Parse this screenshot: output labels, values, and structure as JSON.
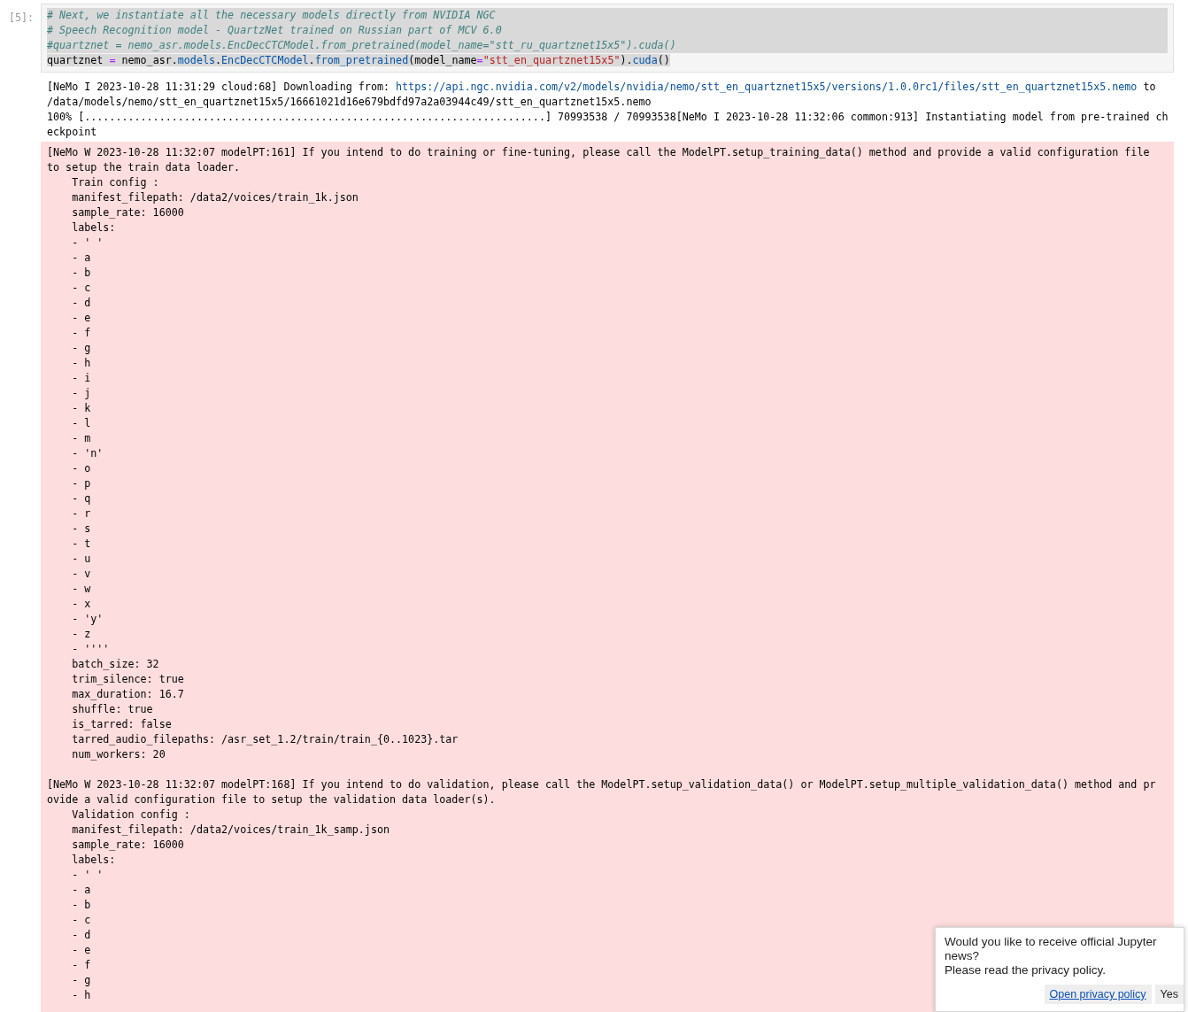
{
  "cell": {
    "prompt": "[5]:",
    "code_lines": [
      {
        "selected": true,
        "tokens": [
          {
            "kind": "comment",
            "text": "# Next, we instantiate all the necessary models directly from NVIDIA NGC"
          }
        ]
      },
      {
        "selected": true,
        "tokens": [
          {
            "kind": "comment",
            "text": "# Speech Recognition model - QuartzNet trained on Russian part of MCV 6.0"
          }
        ]
      },
      {
        "selected": true,
        "tokens": [
          {
            "kind": "comment",
            "text": "#quartznet = nemo_asr.models.EncDecCTCModel.from_pretrained(model_name=\"stt_ru_quartznet15x5\").cuda()"
          }
        ]
      },
      {
        "selected": true,
        "tokens": [
          {
            "kind": "plain",
            "text": "quartznet "
          },
          {
            "kind": "op",
            "text": "="
          },
          {
            "kind": "plain",
            "text": " nemo_asr."
          },
          {
            "kind": "attr",
            "text": "models"
          },
          {
            "kind": "plain",
            "text": "."
          },
          {
            "kind": "attr",
            "text": "EncDecCTCModel"
          },
          {
            "kind": "plain",
            "text": "."
          },
          {
            "kind": "attr",
            "text": "from_pretrained"
          },
          {
            "kind": "plain",
            "text": "(model_name"
          },
          {
            "kind": "op",
            "text": "="
          },
          {
            "kind": "string",
            "text": "\"stt_en_quartznet15x5\""
          },
          {
            "kind": "plain",
            "text": ")."
          },
          {
            "kind": "attr",
            "text": "cuda"
          },
          {
            "kind": "plain",
            "text": "()"
          }
        ]
      }
    ]
  },
  "stdout_lines": [
    [
      {
        "kind": "plain",
        "text": "[NeMo I 2023-10-28 11:31:29 cloud:68] Downloading from: "
      },
      {
        "kind": "link",
        "text": "https://api.ngc.nvidia.com/v2/models/nvidia/nemo/stt_en_quartznet15x5/versions/1.0.0rc1/files/stt_en_quartznet15x5.nemo"
      },
      {
        "kind": "plain",
        "text": " to"
      }
    ],
    [
      {
        "kind": "plain",
        "text": "/data/models/nemo/stt_en_quartznet15x5/16661021d16e679bdfd97a2a03944c49/stt_en_quartznet15x5.nemo"
      }
    ],
    [
      {
        "kind": "plain",
        "text": "100% [..........................................................................] 70993538 / 70993538[NeMo I 2023-10-28 11:32:06 common:913] Instantiating model from pre-trained ch"
      }
    ],
    [
      {
        "kind": "plain",
        "text": "eckpoint"
      }
    ]
  ],
  "warnings": [
    [
      "[NeMo W 2023-10-28 11:32:07 modelPT:161] If you intend to do training or fine-tuning, please call the ModelPT.setup_training_data() method and provide a valid configuration file",
      "to setup the train data loader.",
      "    Train config :",
      "    manifest_filepath: /data2/voices/train_1k.json",
      "    sample_rate: 16000",
      "    labels:",
      "    - ' '",
      "    - a",
      "    - b",
      "    - c",
      "    - d",
      "    - e",
      "    - f",
      "    - g",
      "    - h",
      "    - i",
      "    - j",
      "    - k",
      "    - l",
      "    - m",
      "    - 'n'",
      "    - o",
      "    - p",
      "    - q",
      "    - r",
      "    - s",
      "    - t",
      "    - u",
      "    - v",
      "    - w",
      "    - x",
      "    - 'y'",
      "    - z",
      "    - ''''",
      "    batch_size: 32",
      "    trim_silence: true",
      "    max_duration: 16.7",
      "    shuffle: true",
      "    is_tarred: false",
      "    tarred_audio_filepaths: /asr_set_1.2/train/train_{0..1023}.tar",
      "    num_workers: 20"
    ],
    [
      "[NeMo W 2023-10-28 11:32:07 modelPT:168] If you intend to do validation, please call the ModelPT.setup_validation_data() or ModelPT.setup_multiple_validation_data() method and pr",
      "ovide a valid configuration file to setup the validation data loader(s).",
      "    Validation config :",
      "    manifest_filepath: /data2/voices/train_1k_samp.json",
      "    sample_rate: 16000",
      "    labels:",
      "    - ' '",
      "    - a",
      "    - b",
      "    - c",
      "    - d",
      "    - e",
      "    - f",
      "    - g",
      "    - h"
    ]
  ],
  "notification": {
    "message_lines": [
      "Would you like to receive official Jupyter news?",
      "Please read the privacy policy."
    ],
    "buttons": [
      {
        "kind": "link",
        "label": "Open privacy policy"
      },
      {
        "kind": "plain",
        "label": "Yes"
      }
    ]
  }
}
